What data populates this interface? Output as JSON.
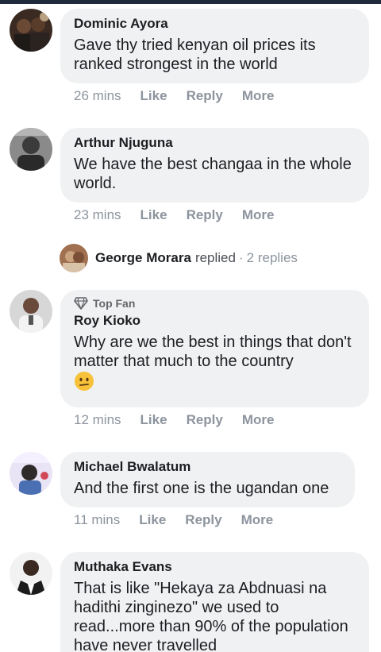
{
  "comments": [
    {
      "author": "Dominic Ayora",
      "text": "Gave thy tried kenyan oil prices its ranked strongest in the world",
      "time": "26 mins",
      "like": "Like",
      "reply": "Reply",
      "more": "More"
    },
    {
      "author": "Arthur Njuguna",
      "text": "We have the best changaa in the whole world.",
      "time": "23 mins",
      "like": "Like",
      "reply": "Reply",
      "more": "More"
    },
    {
      "author": "Roy Kioko",
      "badge": "Top Fan",
      "text": "Why are we the best in things that don't matter that much to the country",
      "emoji": "confused-face",
      "time": "12 mins",
      "like": "Like",
      "reply": "Reply",
      "more": "More"
    },
    {
      "author": "Michael Bwalatum",
      "text": "And the first one is the ugandan one",
      "time": "11 mins",
      "like": "Like",
      "reply": "Reply",
      "more": "More"
    },
    {
      "author": "Muthaka Evans",
      "text": "That is like \"Hekaya za Abdnuasi na hadithi zinginezo\" we used to read...more than 90% of the population have never travelled"
    }
  ],
  "replies": {
    "author": "George Morara",
    "verb": "replied",
    "separator": "·",
    "count": "2 replies"
  },
  "colors": {
    "bubble": "#eff1f3",
    "meta": "#8d949e"
  }
}
